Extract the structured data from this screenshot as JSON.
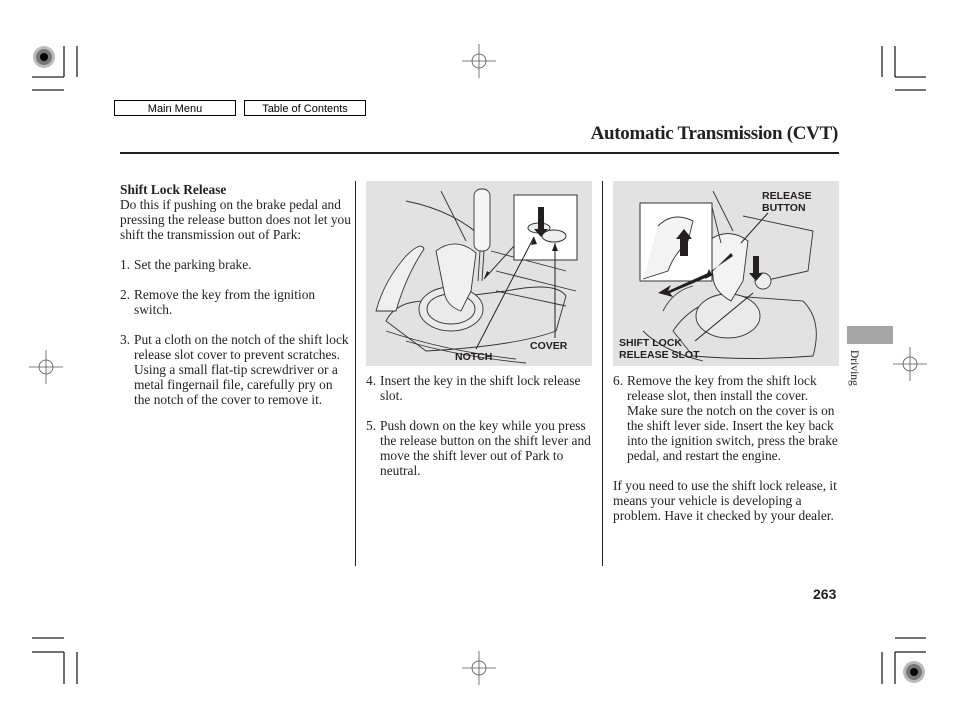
{
  "nav": {
    "main_menu": "Main Menu",
    "table_of_contents": "Table of Contents"
  },
  "header": {
    "title": "Automatic Transmission (CVT)"
  },
  "column1": {
    "heading": "Shift Lock Release",
    "intro": "Do this if pushing on the brake pedal and pressing the release button does not let you shift the transmission out of Park:",
    "steps": [
      {
        "num": "1.",
        "text": "Set the parking brake."
      },
      {
        "num": "2.",
        "text": "Remove the key from the ignition switch."
      },
      {
        "num": "3.",
        "text": "Put a cloth on the notch of the shift lock release slot cover to prevent scratches. Using a small flat-tip screwdriver or a metal fingernail file, carefully pry on the notch of the cover to remove it."
      }
    ]
  },
  "column2": {
    "figure": {
      "labels": {
        "notch": "NOTCH",
        "cover": "COVER"
      }
    },
    "steps": [
      {
        "num": "4.",
        "text": "Insert the key in the shift lock release slot."
      },
      {
        "num": "5.",
        "text": "Push down on the key while you press the release button on the shift lever and move the shift lever out of Park to neutral."
      }
    ]
  },
  "column3": {
    "figure": {
      "labels": {
        "release_button": "RELEASE BUTTON",
        "shift_lock_release_slot": "SHIFT LOCK RELEASE SLOT"
      }
    },
    "steps": [
      {
        "num": "6.",
        "text": "Remove the key from the shift lock release slot, then install the cover. Make sure the notch on the cover is on the shift lever side. Insert the key back into the ignition switch, press the brake pedal, and restart the engine."
      }
    ],
    "note": "If you need to use the shift lock release, it means your vehicle is developing a problem. Have it checked by your dealer."
  },
  "side_tab": {
    "label": "Driving",
    "color": "#a5a5a5"
  },
  "page_number": "263"
}
